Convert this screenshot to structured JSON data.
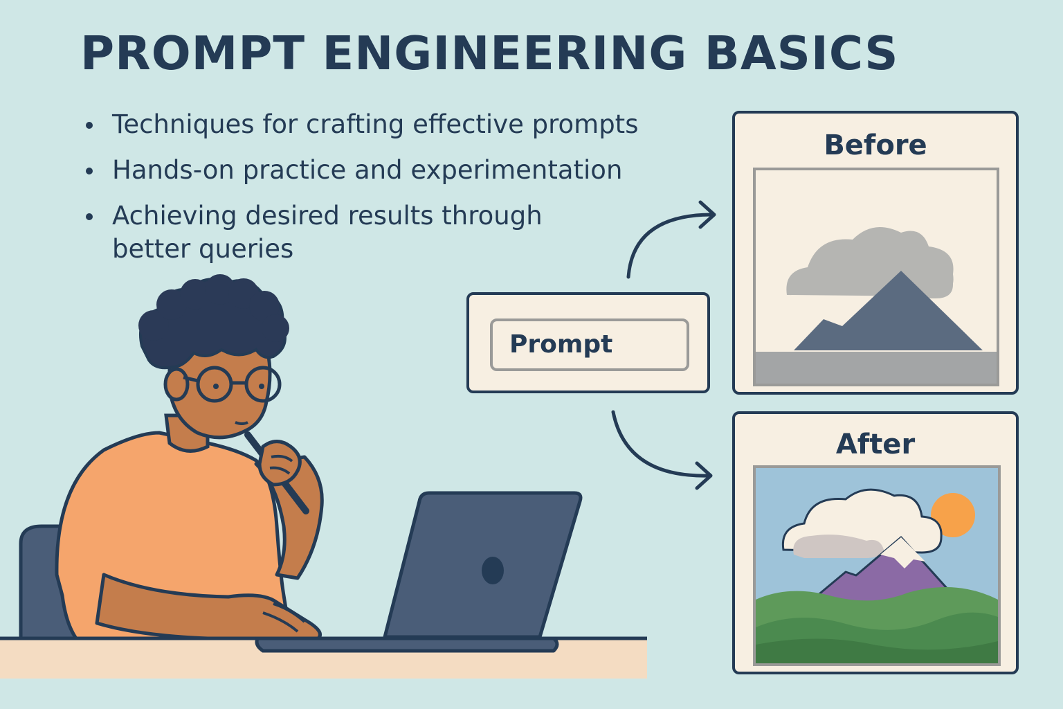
{
  "title": "PROMPT ENGINEERING BASICS",
  "bullets": [
    "Techniques for crafting effective prompts",
    "Hands-on practice and experimentation",
    "Achieving desired results through better queries"
  ],
  "prompt_box": {
    "label": "Prompt"
  },
  "before_panel": {
    "label": "Before"
  },
  "after_panel": {
    "label": "After"
  },
  "colors": {
    "background": "#cfe7e6",
    "ink": "#243b55",
    "panel": "#f7efe2",
    "shirt": "#f5a56c",
    "skin": "#c47d4c",
    "laptop": "#4a5d78",
    "sun": "#f7a24a"
  }
}
